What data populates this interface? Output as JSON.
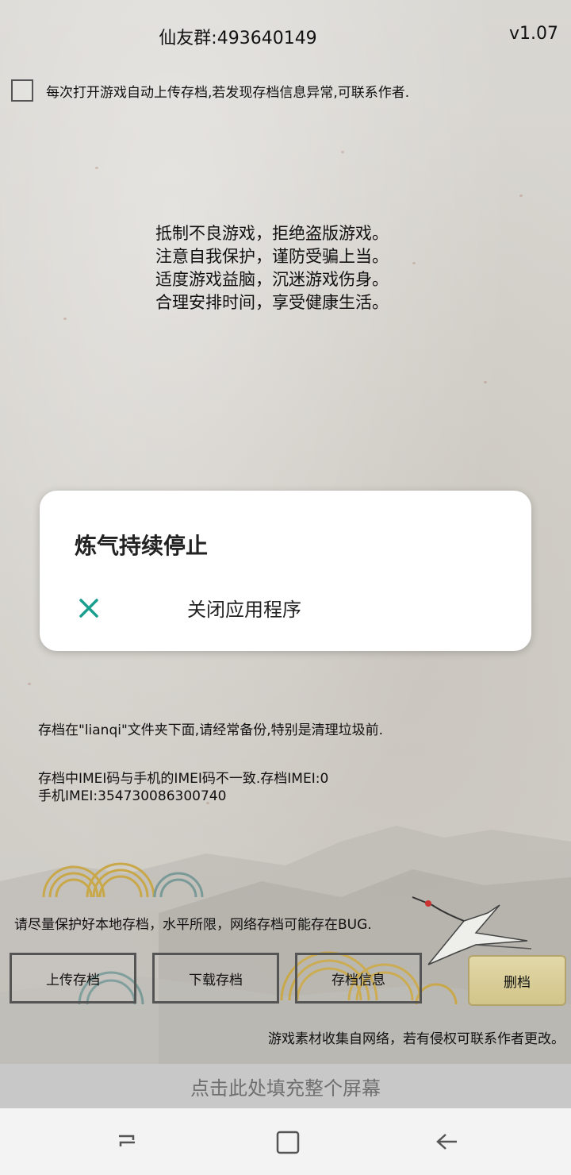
{
  "header": {
    "group_label": "仙友群:493640149",
    "version": "v1.07"
  },
  "auto_upload": {
    "label": "每次打开游戏自动上传存档,若发现存档信息异常,可联系作者.",
    "checked": false
  },
  "slogans": [
    "抵制不良游戏，拒绝盗版游戏。",
    "注意自我保护，谨防受骗上当。",
    "适度游戏益脑，沉迷游戏伤身。",
    "合理安排时间，享受健康生活。"
  ],
  "dialog": {
    "title": "炼气持续停止",
    "close_action": "关闭应用程序",
    "close_icon": "close-icon",
    "accent": "#1a9e8f"
  },
  "info": {
    "backup": "存档在\"lianqi\"文件夹下面,请经常备份,特别是清理垃圾前.",
    "imei_line1": "存档中IMEI码与手机的IMEI码不一致.存档IMEI:0",
    "imei_line2": "手机IMEI:354730086300740",
    "warning": "请尽量保护好本地存档，水平所限，网络存档可能存在BUG."
  },
  "buttons": {
    "upload": "上传存档",
    "download": "下载存档",
    "info": "存档信息",
    "delete": "删档"
  },
  "credit": "游戏素材收集自网络，若有侵权可联系作者更改。",
  "fill_screen": "点击此处填充整个屏幕",
  "nav": {
    "recent": "recent-apps-icon",
    "home": "home-icon",
    "back": "back-icon"
  }
}
